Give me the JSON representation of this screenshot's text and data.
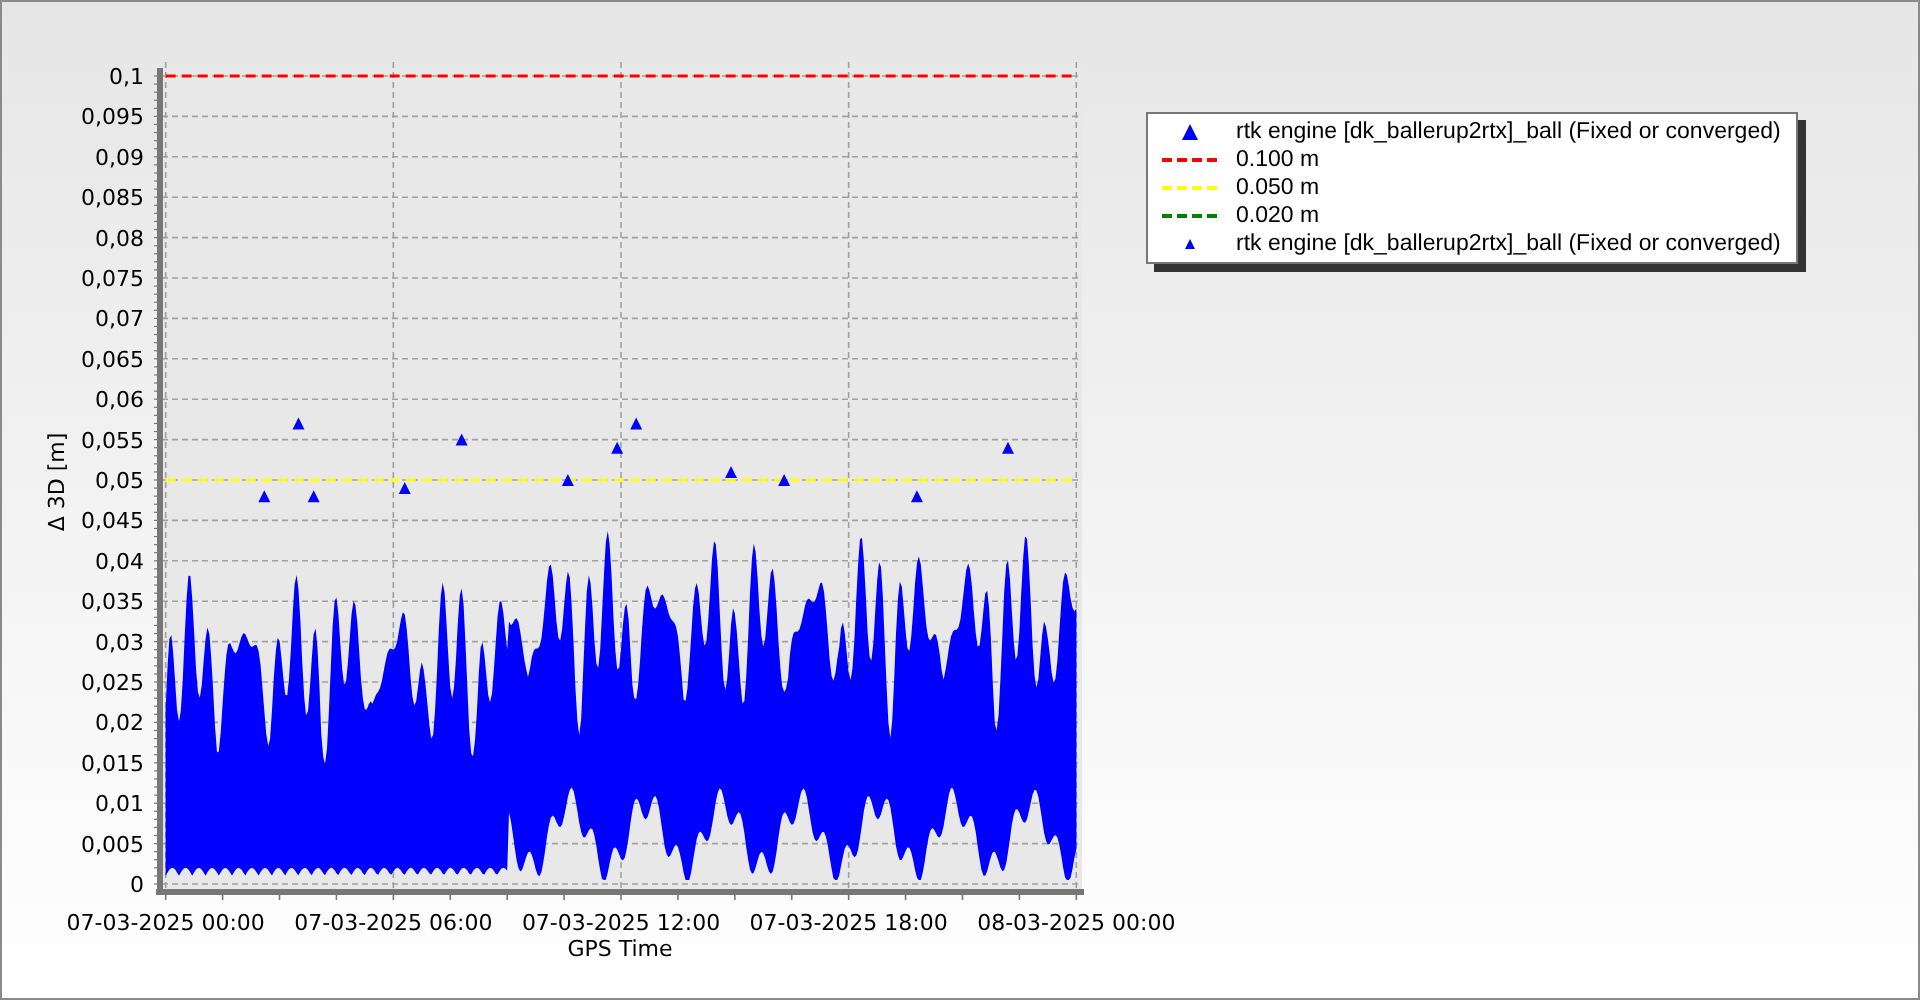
{
  "chart": {
    "chart_data": {
      "type": "line",
      "grid": true,
      "xlabel": "GPS Time",
      "ylabel": "Δ 3D [m]",
      "categories": [
        "07-03-2025 00:00",
        "07-03-2025 06:00",
        "07-03-2025 12:00",
        "07-03-2025 18:00",
        "08-03-2025 00:00"
      ],
      "ylim": [
        0,
        0.1
      ],
      "yticks": [
        {
          "value": 0,
          "label": "0"
        },
        {
          "value": 0.005,
          "label": "0,005"
        },
        {
          "value": 0.01,
          "label": "0,01"
        },
        {
          "value": 0.015,
          "label": "0,015"
        },
        {
          "value": 0.02,
          "label": "0,02"
        },
        {
          "value": 0.025,
          "label": "0,025"
        },
        {
          "value": 0.03,
          "label": "0,03"
        },
        {
          "value": 0.035,
          "label": "0,035"
        },
        {
          "value": 0.04,
          "label": "0,04"
        },
        {
          "value": 0.045,
          "label": "0,045"
        },
        {
          "value": 0.05,
          "label": "0,05"
        },
        {
          "value": 0.055,
          "label": "0,055"
        },
        {
          "value": 0.06,
          "label": "0,06"
        },
        {
          "value": 0.065,
          "label": "0,065"
        },
        {
          "value": 0.07,
          "label": "0,07"
        },
        {
          "value": 0.075,
          "label": "0,075"
        },
        {
          "value": 0.08,
          "label": "0,08"
        },
        {
          "value": 0.085,
          "label": "0,085"
        },
        {
          "value": 0.09,
          "label": "0,09"
        },
        {
          "value": 0.095,
          "label": "0,095"
        },
        {
          "value": 0.1,
          "label": "0,1"
        }
      ],
      "series": [
        {
          "name": "0.100 m",
          "color": "#ff0000",
          "line_style": "dashed",
          "values": [
            0.1,
            0.1,
            0.1,
            0.1,
            0.1
          ]
        },
        {
          "name": "0.050 m",
          "color": "#ffff00",
          "line_style": "dashed",
          "values": [
            0.05,
            0.05,
            0.05,
            0.05,
            0.05
          ]
        }
      ]
    }
  },
  "legend": {
    "items": [
      {
        "kind": "large-marker",
        "color": "#0000ff",
        "label": "rtk engine [dk_ballerup2rtx]_ball (Fixed or converged)"
      },
      {
        "kind": "dashed-line",
        "color": "#008000",
        "label": "0.020 m"
      },
      {
        "kind": "small-marker",
        "color": "#0000ff",
        "label": "rtk engine [dk_ballerup2rtx]_ball (Fixed or converged)"
      }
    ]
  }
}
